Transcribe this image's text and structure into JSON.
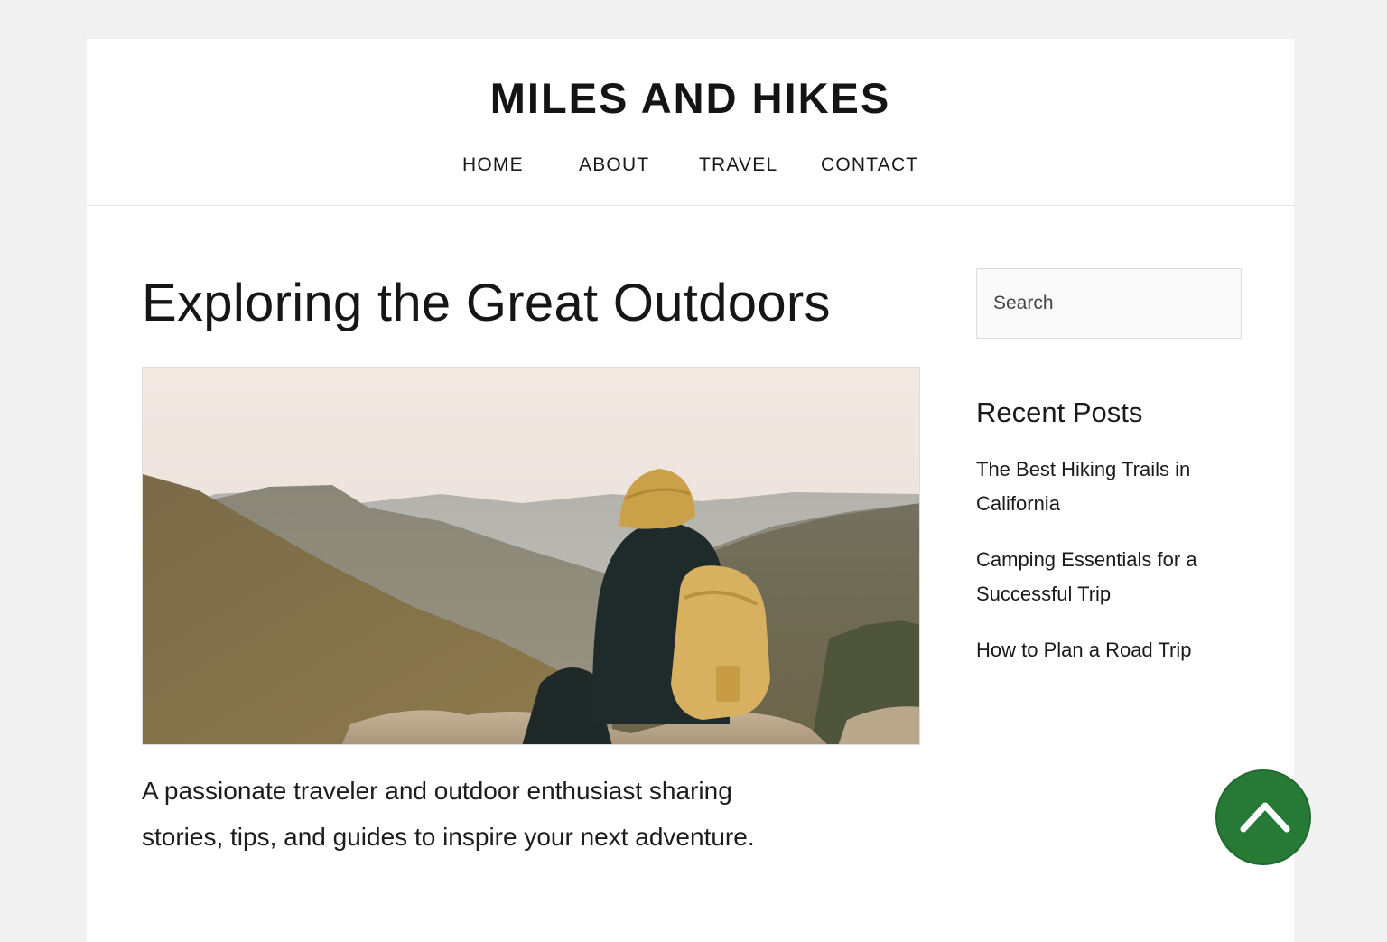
{
  "site": {
    "title": "MILES AND HIKES"
  },
  "nav": {
    "items": [
      {
        "label": "HOME"
      },
      {
        "label": "ABOUT"
      },
      {
        "label": "TRAVEL"
      },
      {
        "label": "CONTACT"
      }
    ]
  },
  "main": {
    "post_title": "Exploring the Great Outdoors",
    "hero_image": "hiker-on-mountain-overlook",
    "intro_line1": "A passionate traveler and outdoor enthusiast sharing",
    "intro_line2": "stories, tips, and guides to inspire your next adventure."
  },
  "sidebar": {
    "search": {
      "placeholder": "Search",
      "value": ""
    },
    "recent_posts": {
      "title": "Recent Posts",
      "items": [
        {
          "line1": "The Best Hiking Trails in",
          "line2": "California"
        },
        {
          "line1": "Camping Essentials for a",
          "line2": "Successful Trip"
        },
        {
          "line1": "How to Plan a Road Trip",
          "line2": ""
        }
      ]
    }
  },
  "scroll_top": {
    "icon": "chevron-up-icon",
    "color": "#277a36"
  }
}
